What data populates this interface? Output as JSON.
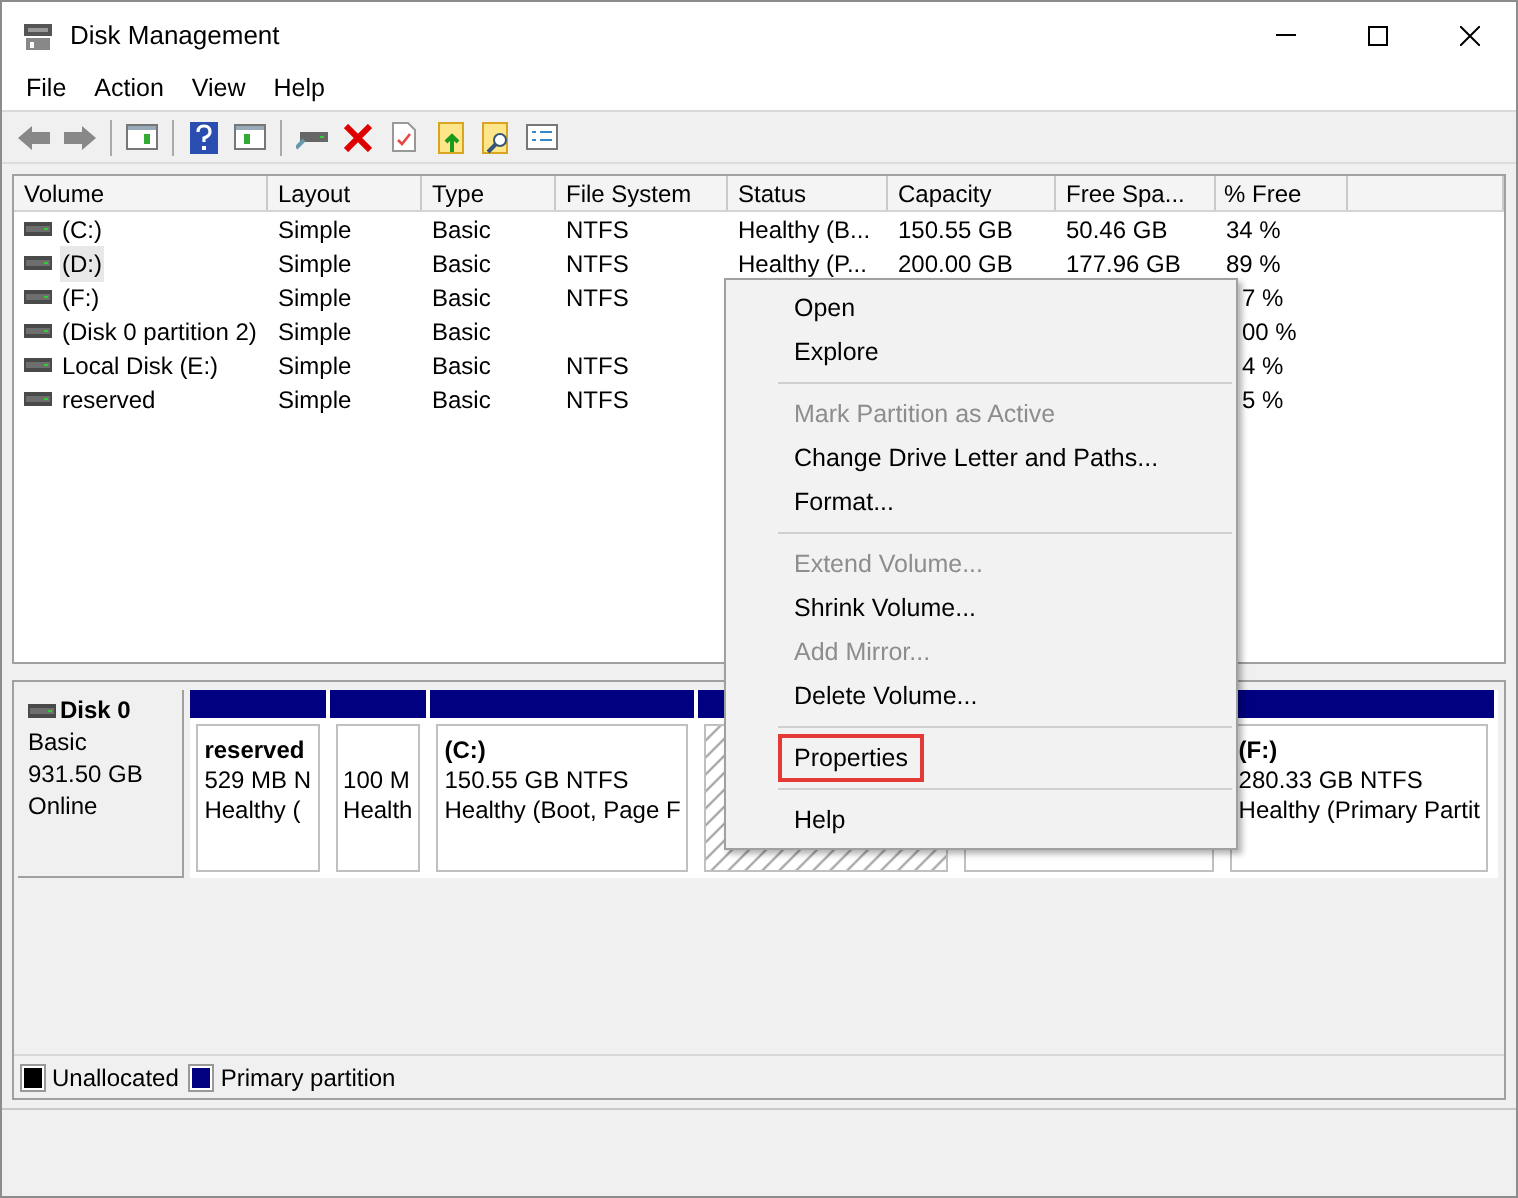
{
  "window": {
    "title": "Disk Management"
  },
  "menu_bar": [
    "File",
    "Action",
    "View",
    "Help"
  ],
  "volume_table": {
    "columns": [
      "Volume",
      "Layout",
      "Type",
      "File System",
      "Status",
      "Capacity",
      "Free Spa...",
      "% Free"
    ],
    "rows": [
      {
        "cells": [
          "(C:)",
          "Simple",
          "Basic",
          "NTFS",
          "Healthy (B...",
          "150.55 GB",
          "50.46 GB",
          "34 %"
        ],
        "selected": false
      },
      {
        "cells": [
          "(D:)",
          "Simple",
          "Basic",
          "NTFS",
          "Healthy (P...",
          "200.00 GB",
          "177.96 GB",
          "89 %"
        ],
        "selected": true
      },
      {
        "cells": [
          "(F:)",
          "Simple",
          "Basic",
          "NTFS",
          "",
          "",
          "",
          "7 %"
        ],
        "selected": false
      },
      {
        "cells": [
          "(Disk 0 partition 2)",
          "Simple",
          "Basic",
          "",
          "",
          "",
          "",
          "00 %"
        ],
        "selected": false
      },
      {
        "cells": [
          "Local Disk  (E:)",
          "Simple",
          "Basic",
          "NTFS",
          "",
          "",
          "",
          "4 %"
        ],
        "selected": false
      },
      {
        "cells": [
          "reserved",
          "Simple",
          "Basic",
          "NTFS",
          "",
          "",
          "",
          "5 %"
        ],
        "selected": false
      }
    ]
  },
  "disk": {
    "name": "Disk 0",
    "type": "Basic",
    "size": "931.50 GB",
    "status": "Online",
    "partitions": [
      {
        "kind": "primary",
        "title": "reserved",
        "lines": [
          "529 MB N",
          "Healthy ("
        ]
      },
      {
        "kind": "primary",
        "lines": [
          "100 M",
          "Health"
        ]
      },
      {
        "kind": "primary",
        "title": "(C:)",
        "lines": [
          "150.55 GB NTFS",
          "Healthy (Boot, Page F"
        ]
      },
      {
        "kind": "hatched"
      },
      {
        "kind": "primary"
      },
      {
        "kind": "primary",
        "title": "(F:)",
        "lines": [
          "280.33 GB NTFS",
          "Healthy (Primary Partit"
        ]
      }
    ]
  },
  "context_menu": [
    {
      "kind": "item",
      "label": "Open",
      "disabled": false,
      "highlighted": false
    },
    {
      "kind": "item",
      "label": "Explore",
      "disabled": false,
      "highlighted": false
    },
    {
      "kind": "separator"
    },
    {
      "kind": "item",
      "label": "Mark Partition as Active",
      "disabled": true,
      "highlighted": false
    },
    {
      "kind": "item",
      "label": "Change Drive Letter and Paths...",
      "disabled": false,
      "highlighted": false
    },
    {
      "kind": "item",
      "label": "Format...",
      "disabled": false,
      "highlighted": false
    },
    {
      "kind": "separator"
    },
    {
      "kind": "item",
      "label": "Extend Volume...",
      "disabled": true,
      "highlighted": false
    },
    {
      "kind": "item",
      "label": "Shrink Volume...",
      "disabled": false,
      "highlighted": false
    },
    {
      "kind": "item",
      "label": "Add Mirror...",
      "disabled": true,
      "highlighted": false
    },
    {
      "kind": "item",
      "label": "Delete Volume...",
      "disabled": false,
      "highlighted": false
    },
    {
      "kind": "separator"
    },
    {
      "kind": "item",
      "label": "Properties",
      "disabled": false,
      "highlighted": true
    },
    {
      "kind": "separator"
    },
    {
      "kind": "item",
      "label": "Help",
      "disabled": false,
      "highlighted": false
    }
  ],
  "legend": [
    {
      "label": "Unallocated",
      "color": "#000000"
    },
    {
      "label": "Primary partition",
      "color": "#000080"
    }
  ]
}
